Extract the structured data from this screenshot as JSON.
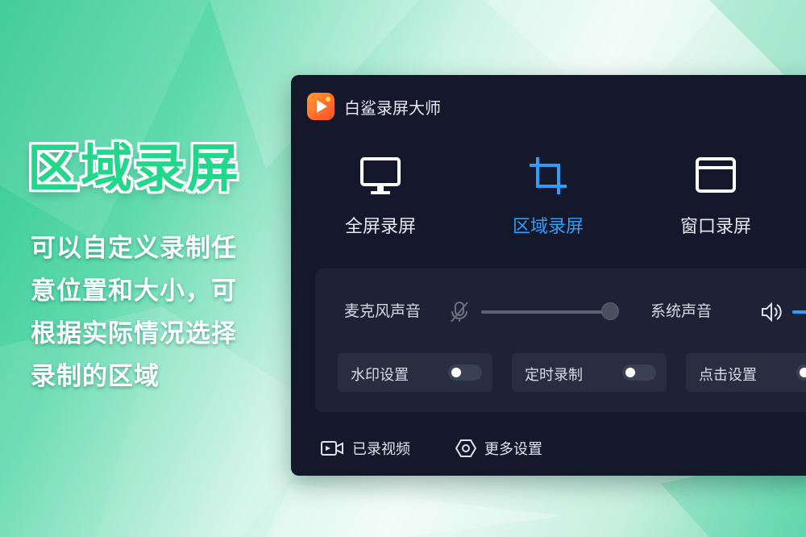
{
  "promo": {
    "title": "区域录屏",
    "desc_lines": [
      "可以自定义录制任",
      "意位置和大小，可",
      "根据实际情况选择",
      "录制的区域"
    ]
  },
  "app": {
    "title": "白鲨录屏大师",
    "modes": [
      {
        "label": "全屏录屏",
        "icon": "monitor-icon",
        "active": false
      },
      {
        "label": "区域录屏",
        "icon": "crop-icon",
        "active": true
      },
      {
        "label": "窗口录屏",
        "icon": "window-icon",
        "active": false
      }
    ],
    "audio": {
      "mic_label": "麦克风声音",
      "mic_muted": true,
      "mic_level": 1.0,
      "system_label": "系统声音"
    },
    "options": [
      {
        "label": "水印设置",
        "enabled": false
      },
      {
        "label": "定时录制",
        "enabled": false
      },
      {
        "label": "点击设置",
        "enabled": false
      }
    ],
    "footer": {
      "recorded_label": "已录视频",
      "more_label": "更多设置"
    }
  },
  "colors": {
    "accent": "#2f9cff",
    "promo_green": "#22d68b",
    "window_bg": "#14182a"
  }
}
